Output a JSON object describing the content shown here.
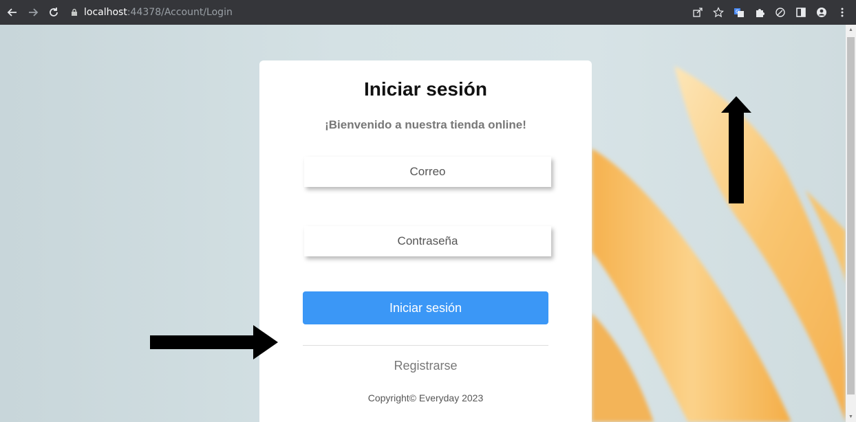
{
  "browser": {
    "url_host": "localhost",
    "url_path": ":44378/Account/Login"
  },
  "login": {
    "title": "Iniciar sesión",
    "subtitle": "¡Bienvenido a nuestra tienda online!",
    "email_placeholder": "Correo",
    "password_placeholder": "Contraseña",
    "submit_label": "Iniciar sesión",
    "register_label": "Registrarse",
    "copyright": "Copyright© Everyday 2023"
  },
  "colors": {
    "primary_button": "#3b97f6",
    "chrome_bar": "#35363a",
    "background": "#d4e1e4",
    "accent_petal": "#f8c265"
  },
  "icons": {
    "chrome": [
      "back-arrow-icon",
      "forward-arrow-icon",
      "reload-icon",
      "lock-icon",
      "share-icon",
      "star-icon",
      "translate-icon",
      "puzzle-icon",
      "leaf-icon",
      "side-panel-icon",
      "profile-icon",
      "more-vertical-icon"
    ],
    "annotations": [
      "black-arrow-right-icon",
      "black-arrow-up-icon"
    ]
  }
}
